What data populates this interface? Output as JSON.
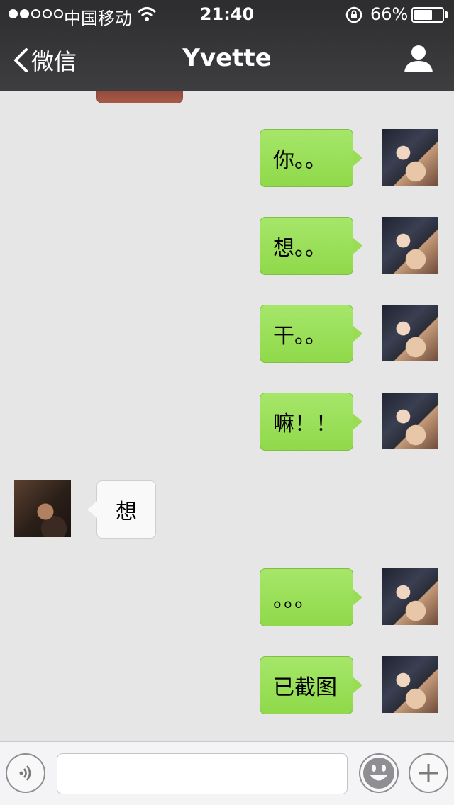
{
  "status_bar": {
    "carrier": "中国移动",
    "time": "21:40",
    "battery_percent": "66%",
    "battery_level": 0.66,
    "signal_bars_filled": 2,
    "signal_bars_total": 5
  },
  "nav": {
    "back_label": "微信",
    "title": "Yvette",
    "back_icon": "chevron-left-icon",
    "profile_icon": "person-icon"
  },
  "messages": [
    {
      "side": "out",
      "text": "你。。"
    },
    {
      "side": "out",
      "text": "想。。"
    },
    {
      "side": "out",
      "text": "干。。"
    },
    {
      "side": "out",
      "text": "嘛！！"
    },
    {
      "side": "in",
      "text": "想"
    },
    {
      "side": "out",
      "text": "。。。"
    },
    {
      "side": "out",
      "text": "已截图"
    }
  ],
  "input_bar": {
    "voice_icon": "voice-icon",
    "emoji_icon": "emoji-icon",
    "plus_icon": "plus-icon",
    "placeholder": ""
  },
  "colors": {
    "outgoing_bubble": "#9ade57",
    "incoming_bubble": "#f9f9f9",
    "nav_bar": "#353537",
    "chat_background": "#e6e6e6"
  }
}
